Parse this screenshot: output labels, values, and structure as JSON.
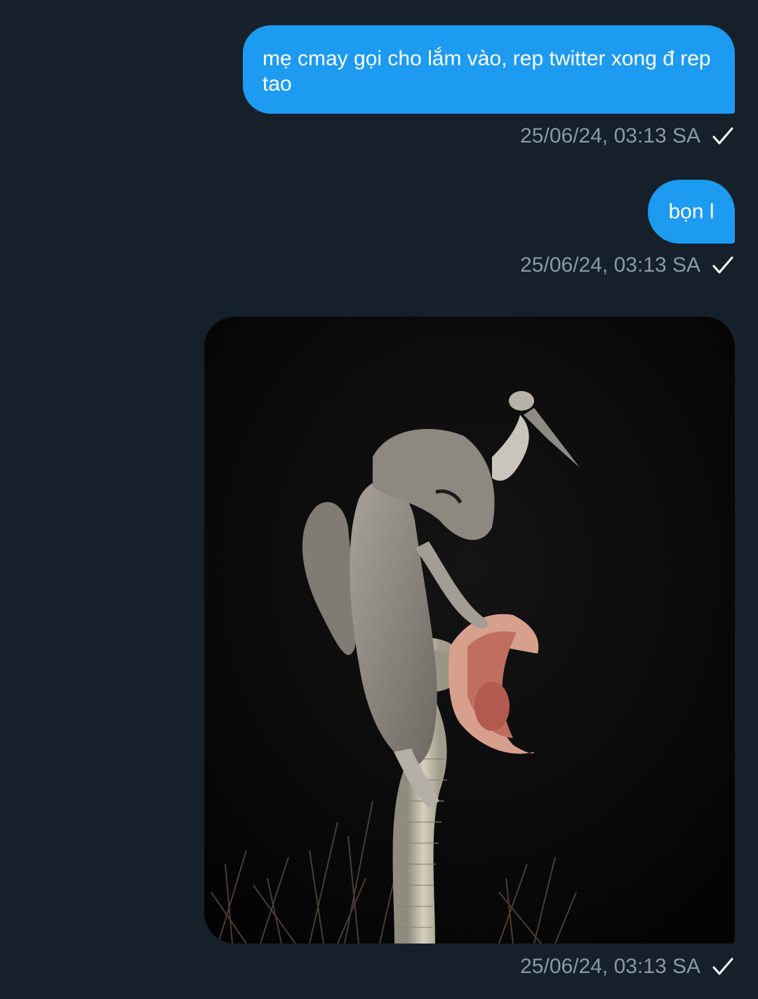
{
  "messages": [
    {
      "text": "mẹ cmay gọi cho lắm vào, rep twitter xong đ rep tao",
      "timestamp": "25/06/24, 03:13 SA"
    },
    {
      "text": "bọn l",
      "timestamp": "25/06/24, 03:13 SA"
    },
    {
      "timestamp": "25/06/24, 03:13 SA"
    }
  ],
  "colors": {
    "background": "#15202b",
    "bubble": "#1d9bf0",
    "meta_text": "#8b98a5",
    "check": "#ffffff"
  },
  "icons": {
    "sent_status": "check-icon"
  }
}
